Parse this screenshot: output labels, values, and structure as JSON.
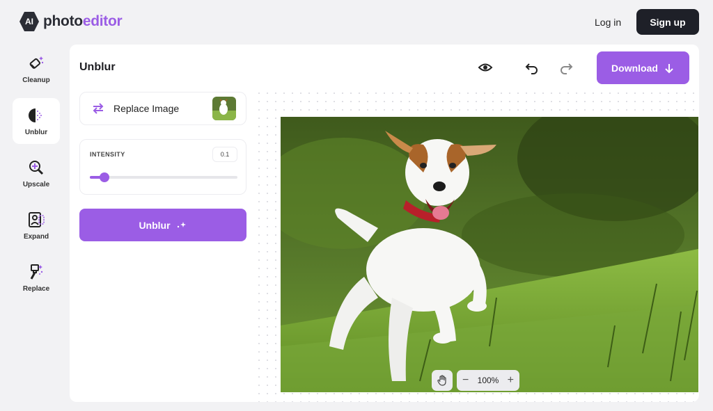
{
  "header": {
    "logo_badge": "AI",
    "logo_part1": "photo",
    "logo_part2": "editor",
    "login_label": "Log in",
    "signup_label": "Sign up"
  },
  "tools": [
    {
      "label": "Cleanup",
      "icon": "eraser-icon"
    },
    {
      "label": "Unblur",
      "icon": "unblur-icon",
      "active": true
    },
    {
      "label": "Upscale",
      "icon": "magnify-icon"
    },
    {
      "label": "Expand",
      "icon": "expand-icon"
    },
    {
      "label": "Replace",
      "icon": "brush-icon"
    }
  ],
  "editor": {
    "title": "Unblur",
    "download_label": "Download",
    "replace_label": "Replace Image",
    "intensity_label": "INTENSITY",
    "intensity_value": "0.1",
    "intensity_fraction": 0.1,
    "unblur_label": "Unblur",
    "zoom_label": "100%"
  },
  "colors": {
    "accent": "#9b5de5",
    "dark": "#1e2028"
  }
}
